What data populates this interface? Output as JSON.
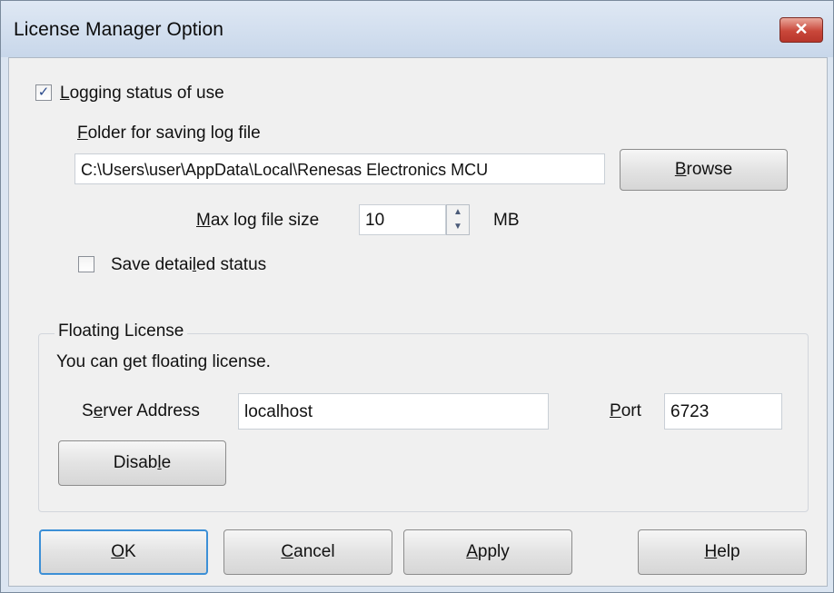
{
  "window": {
    "title": "License Manager Option",
    "close_glyph": "✕"
  },
  "logging": {
    "checkbox_checked": true,
    "check_glyph": "✓",
    "label_mnemonic": "L",
    "label_rest": "ogging status of use",
    "folder_label_mnemonic": "F",
    "folder_label_rest": "older for saving log file",
    "folder_value": "C:\\Users\\user\\AppData\\Local\\Renesas Electronics MCU",
    "browse_label_mnemonic": "B",
    "browse_label_rest": "rowse",
    "max_size_label_mnemonic": "M",
    "max_size_label_rest": "ax log file size",
    "max_size_value": "10",
    "max_size_unit": "MB",
    "spin_up_glyph": "▲",
    "spin_down_glyph": "▼",
    "save_detail_checked": false,
    "save_detail_label_pre": "Save detai",
    "save_detail_label_mnemonic": "l",
    "save_detail_label_post": "ed status"
  },
  "floating": {
    "group_title": "Floating License",
    "message": "You can get floating license.",
    "server_label_pre": "S",
    "server_label_mnemonic": "e",
    "server_label_post": "rver Address",
    "server_value": "localhost",
    "port_label_mnemonic": "P",
    "port_label_rest": "ort",
    "port_value": "6723",
    "disable_label_pre": "Disab",
    "disable_label_mnemonic": "l",
    "disable_label_post": "e"
  },
  "buttons": {
    "ok_mnemonic": "O",
    "ok_rest": "K",
    "cancel_mnemonic": "C",
    "cancel_rest": "ancel",
    "apply_mnemonic": "A",
    "apply_rest": "pply",
    "help_mnemonic": "H",
    "help_rest": "elp"
  }
}
